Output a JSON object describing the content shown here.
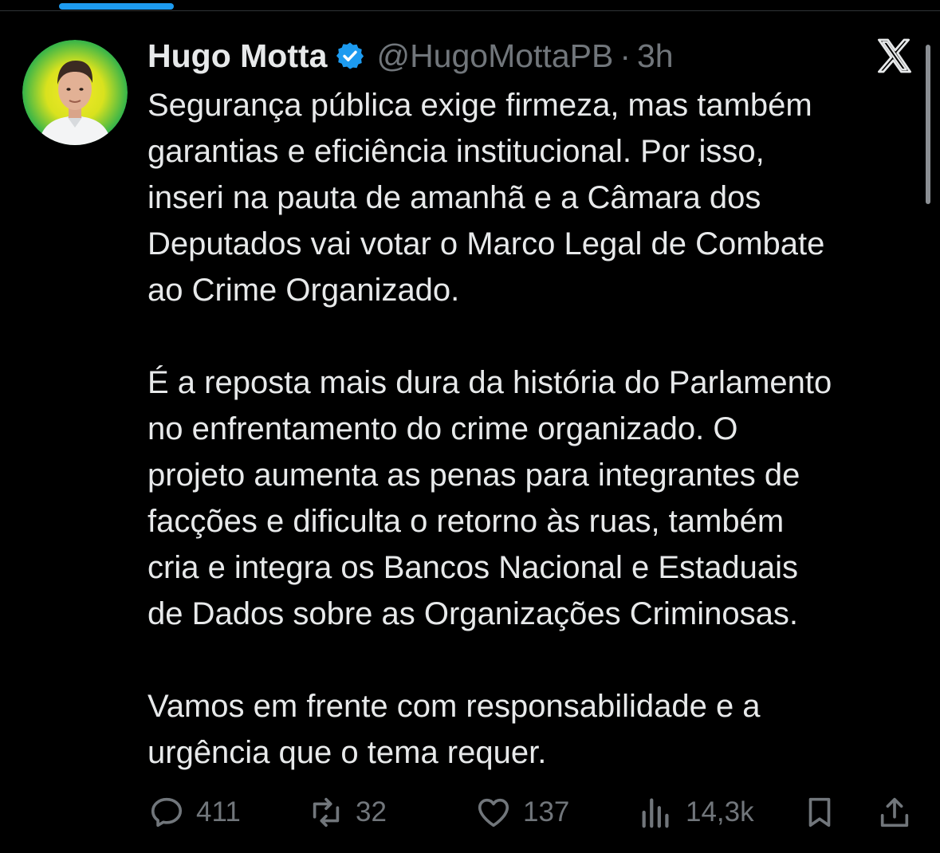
{
  "colors": {
    "background": "#000000",
    "text": "#e7e9ea",
    "muted": "#71767b",
    "accent": "#1d9bf0"
  },
  "author": {
    "display_name": "Hugo Motta",
    "handle": "@HugoMottaPB",
    "separator": "·",
    "time": "3h",
    "verified_icon": "verified-badge-icon",
    "avatar": "profile-photo"
  },
  "brand_icon": "x-logo-icon",
  "tweet": {
    "paragraphs": [
      {
        "lines": [
          "Segurança pública exige firmeza, mas também",
          "garantias e eficiência institucional. Por isso,",
          "inseri na pauta de amanhã e a Câmara dos",
          "Deputados vai votar o Marco Legal de Combate",
          "ao Crime Organizado."
        ]
      },
      {
        "lines": [
          "É a reposta mais dura da história do Parlamento",
          "no enfrentamento do crime organizado. O",
          "projeto aumenta as penas para integrantes de",
          "facções e dificulta o retorno às ruas, também",
          "cria e integra os Bancos Nacional e Estaduais",
          "de Dados sobre as Organizações Criminosas."
        ]
      },
      {
        "lines": [
          "Vamos em frente com responsabilidade e a",
          "urgência que o tema requer."
        ]
      }
    ]
  },
  "actions": {
    "reply": {
      "icon": "reply-icon",
      "count": "411"
    },
    "retweet": {
      "icon": "retweet-icon",
      "count": "32"
    },
    "like": {
      "icon": "heart-icon",
      "count": "137"
    },
    "views": {
      "icon": "views-icon",
      "count": "14,3k"
    },
    "bookmark": {
      "icon": "bookmark-icon"
    },
    "share": {
      "icon": "share-icon"
    }
  }
}
